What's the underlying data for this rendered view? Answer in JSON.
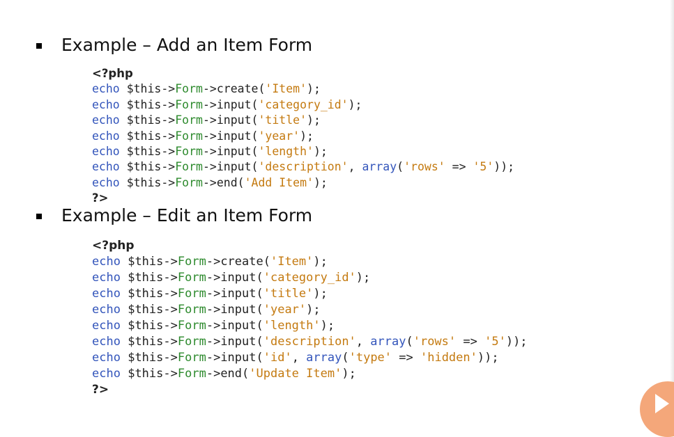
{
  "sections": [
    {
      "title": "Example – Add an Item Form",
      "open_tag": "<?php",
      "close_tag": "?>",
      "lines": [
        {
          "echo": "echo",
          "this": "$this",
          "arrow1": "->",
          "form": "Form",
          "arrow2": "->",
          "method": "create(",
          "args": [
            {
              "t": "str",
              "v": "'Item'"
            }
          ],
          "tail": ");"
        },
        {
          "echo": "echo",
          "this": "$this",
          "arrow1": "->",
          "form": "Form",
          "arrow2": "->",
          "method": "input(",
          "args": [
            {
              "t": "str",
              "v": "'category_id'"
            }
          ],
          "tail": ");"
        },
        {
          "echo": "echo",
          "this": "$this",
          "arrow1": "->",
          "form": "Form",
          "arrow2": "->",
          "method": "input(",
          "args": [
            {
              "t": "str",
              "v": "'title'"
            }
          ],
          "tail": ");"
        },
        {
          "echo": "echo",
          "this": "$this",
          "arrow1": "->",
          "form": "Form",
          "arrow2": "->",
          "method": "input(",
          "args": [
            {
              "t": "str",
              "v": "'year'"
            }
          ],
          "tail": ");"
        },
        {
          "echo": "echo",
          "this": "$this",
          "arrow1": "->",
          "form": "Form",
          "arrow2": "->",
          "method": "input(",
          "args": [
            {
              "t": "str",
              "v": "'length'"
            }
          ],
          "tail": ");"
        },
        {
          "echo": "echo",
          "this": "$this",
          "arrow1": "->",
          "form": "Form",
          "arrow2": "->",
          "method": "input(",
          "args": [
            {
              "t": "str",
              "v": "'description'"
            },
            {
              "t": "plain",
              "v": ", "
            },
            {
              "t": "kw",
              "v": "array"
            },
            {
              "t": "plain",
              "v": "("
            },
            {
              "t": "str",
              "v": "'rows'"
            },
            {
              "t": "plain",
              "v": " => "
            },
            {
              "t": "str",
              "v": "'5'"
            },
            {
              "t": "plain",
              "v": ")"
            }
          ],
          "tail": ");"
        },
        {
          "echo": "echo",
          "this": "$this",
          "arrow1": "->",
          "form": "Form",
          "arrow2": "->",
          "method": "end(",
          "args": [
            {
              "t": "str",
              "v": "'Add Item'"
            }
          ],
          "tail": ");"
        }
      ]
    },
    {
      "title": "Example – Edit an Item Form",
      "open_tag": "<?php",
      "close_tag": "?>",
      "lines": [
        {
          "echo": "echo",
          "this": "$this",
          "arrow1": "->",
          "form": "Form",
          "arrow2": "->",
          "method": "create(",
          "args": [
            {
              "t": "str",
              "v": "'Item'"
            }
          ],
          "tail": ");"
        },
        {
          "echo": "echo",
          "this": "$this",
          "arrow1": "->",
          "form": "Form",
          "arrow2": "->",
          "method": "input(",
          "args": [
            {
              "t": "str",
              "v": "'category_id'"
            }
          ],
          "tail": ");"
        },
        {
          "echo": "echo",
          "this": "$this",
          "arrow1": "->",
          "form": "Form",
          "arrow2": "->",
          "method": "input(",
          "args": [
            {
              "t": "str",
              "v": "'title'"
            }
          ],
          "tail": ");"
        },
        {
          "echo": "echo",
          "this": "$this",
          "arrow1": "->",
          "form": "Form",
          "arrow2": "->",
          "method": "input(",
          "args": [
            {
              "t": "str",
              "v": "'year'"
            }
          ],
          "tail": ");"
        },
        {
          "echo": "echo",
          "this": "$this",
          "arrow1": "->",
          "form": "Form",
          "arrow2": "->",
          "method": "input(",
          "args": [
            {
              "t": "str",
              "v": "'length'"
            }
          ],
          "tail": ");"
        },
        {
          "echo": "echo",
          "this": "$this",
          "arrow1": "->",
          "form": "Form",
          "arrow2": "->",
          "method": "input(",
          "args": [
            {
              "t": "str",
              "v": "'description'"
            },
            {
              "t": "plain",
              "v": ", "
            },
            {
              "t": "kw",
              "v": "array"
            },
            {
              "t": "plain",
              "v": "("
            },
            {
              "t": "str",
              "v": "'rows'"
            },
            {
              "t": "plain",
              "v": " => "
            },
            {
              "t": "str",
              "v": "'5'"
            },
            {
              "t": "plain",
              "v": ")"
            }
          ],
          "tail": ");"
        },
        {
          "echo": "echo",
          "this": "$this",
          "arrow1": "->",
          "form": "Form",
          "arrow2": "->",
          "method": "input(",
          "args": [
            {
              "t": "str",
              "v": "'id'"
            },
            {
              "t": "plain",
              "v": ", "
            },
            {
              "t": "kw",
              "v": "array"
            },
            {
              "t": "plain",
              "v": "("
            },
            {
              "t": "str",
              "v": "'type'"
            },
            {
              "t": "plain",
              "v": " => "
            },
            {
              "t": "str",
              "v": "'hidden'"
            },
            {
              "t": "plain",
              "v": ")"
            }
          ],
          "tail": ");"
        },
        {
          "echo": "echo",
          "this": "$this",
          "arrow1": "->",
          "form": "Form",
          "arrow2": "->",
          "method": "end(",
          "args": [
            {
              "t": "str",
              "v": "'Update Item'"
            }
          ],
          "tail": ");"
        }
      ]
    }
  ],
  "icons": {
    "corner": "play-logo-icon"
  },
  "colors": {
    "keyword": "#3355bb",
    "object": "#2d8a2d",
    "string": "#c47a10",
    "accent": "#f4a77a"
  }
}
